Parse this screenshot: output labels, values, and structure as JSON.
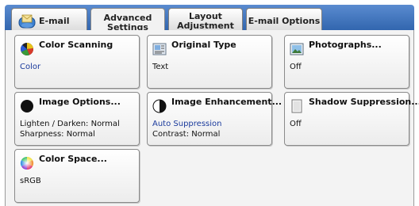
{
  "tabs": [
    {
      "label": "E-mail"
    },
    {
      "label_line1": "Advanced",
      "label_line2": "Settings"
    },
    {
      "label_line1": "Layout",
      "label_line2": "Adjustment"
    },
    {
      "label": "E-mail Options"
    }
  ],
  "buttons": {
    "color_scanning": {
      "title": "Color Scanning",
      "value": "Color"
    },
    "original_type": {
      "title": "Original Type",
      "value": "Text"
    },
    "photographs": {
      "title": "Photographs...",
      "value": "Off"
    },
    "image_options": {
      "title": "Image Options...",
      "value_line1": "Lighten / Darken: Normal",
      "value_line2": "Sharpness: Normal"
    },
    "image_enhancement": {
      "title": "Image Enhancement...",
      "value_line1": "Auto Suppression",
      "value_line2": "Contrast: Normal"
    },
    "shadow_suppression": {
      "title": "Shadow Suppression...",
      "value": "Off"
    },
    "color_space": {
      "title": "Color Space...",
      "value": "sRGB"
    }
  },
  "colors": {
    "value_blue": "#1a3a9c",
    "tabbar_blue": "#2a5fa8"
  }
}
